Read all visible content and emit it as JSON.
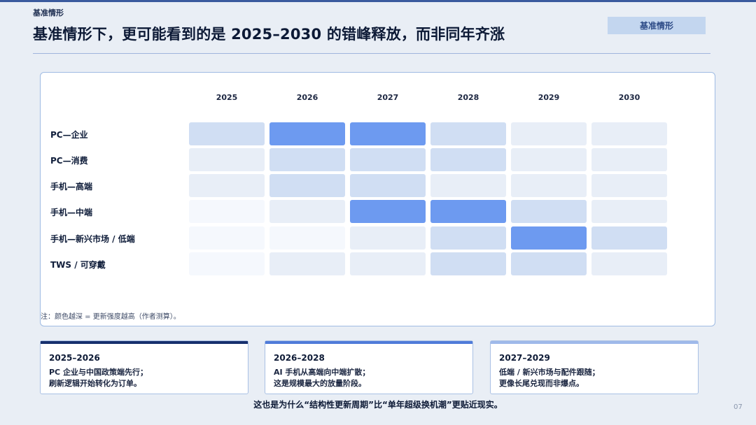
{
  "header": {
    "kicker": "基准情形",
    "title": "基准情形下，更可能看到的是 2025–2030 的错峰释放，而非同年齐涨",
    "tag": "基准情形"
  },
  "heatmap": {
    "years": [
      "2025",
      "2026",
      "2027",
      "2028",
      "2029",
      "2030"
    ],
    "rows": [
      {
        "label": "PC—企业",
        "intensity": [
          2,
          4,
          4,
          2,
          1,
          1
        ]
      },
      {
        "label": "PC—消费",
        "intensity": [
          1,
          2,
          2,
          2,
          1,
          1
        ]
      },
      {
        "label": "手机—高端",
        "intensity": [
          1,
          2,
          2,
          1,
          1,
          1
        ]
      },
      {
        "label": "手机—中端",
        "intensity": [
          0,
          1,
          4,
          4,
          2,
          1
        ]
      },
      {
        "label": "手机—新兴市场 / 低端",
        "intensity": [
          0,
          0,
          1,
          2,
          4,
          2
        ]
      },
      {
        "label": "TWS / 可穿戴",
        "intensity": [
          0,
          1,
          1,
          2,
          2,
          1
        ]
      }
    ],
    "colors": [
      "#f5f8fd",
      "#e8eef7",
      "#d0def3",
      "#d0def3",
      "#6d9af0"
    ],
    "note": "注：颜色越深 = 更新强度越高（作者测算）。"
  },
  "cards": [
    {
      "title": "2025–2026",
      "lines": [
        "PC 企业与中国政策端先行；",
        "刷新逻辑开始转化为订单。"
      ],
      "bar": "#17306e"
    },
    {
      "title": "2026–2028",
      "lines": [
        "AI 手机从高端向中端扩散；",
        "这是规模最大的放量阶段。"
      ],
      "bar": "#4f7bd9"
    },
    {
      "title": "2027–2029",
      "lines": [
        "低端 / 新兴市场与配件跟随；",
        "更像长尾兑现而非爆点。"
      ],
      "bar": "#9fb9ea"
    }
  ],
  "footer": "这也是为什么“结构性更新周期”比“单年超级换机潮”更贴近现实。",
  "page_number": "07"
}
